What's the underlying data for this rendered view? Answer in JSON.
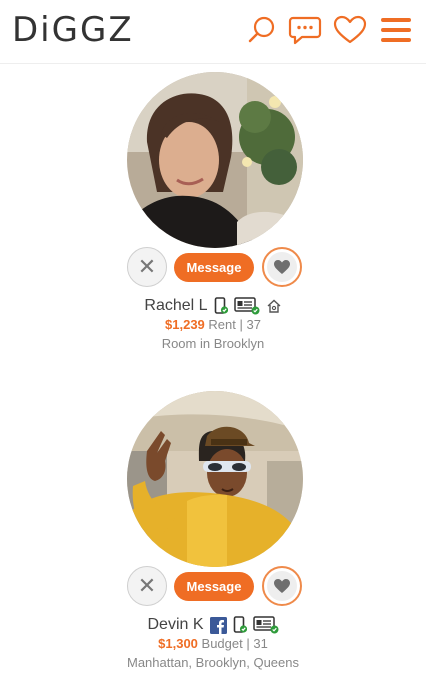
{
  "app": {
    "logo_text": "DiGGZ",
    "accent_color": "#ef6d24",
    "icons": [
      "search-icon",
      "chat-icon",
      "heart-icon",
      "menu-icon"
    ]
  },
  "profiles": [
    {
      "name": "Rachel L",
      "price": "$1,239",
      "type": "Rent",
      "age": "37",
      "location": "Room in Brooklyn",
      "message_label": "Message",
      "dismiss_label": "✕",
      "badges": [
        "phone-verified-icon",
        "id-verified-icon",
        "home-icon"
      ]
    },
    {
      "name": "Devin K",
      "price": "$1,300",
      "type": "Budget",
      "age": "31",
      "location": "Manhattan, Brooklyn, Queens",
      "message_label": "Message",
      "dismiss_label": "✕",
      "badges": [
        "facebook-icon",
        "phone-verified-icon",
        "id-verified-icon"
      ]
    }
  ],
  "separator": "|"
}
